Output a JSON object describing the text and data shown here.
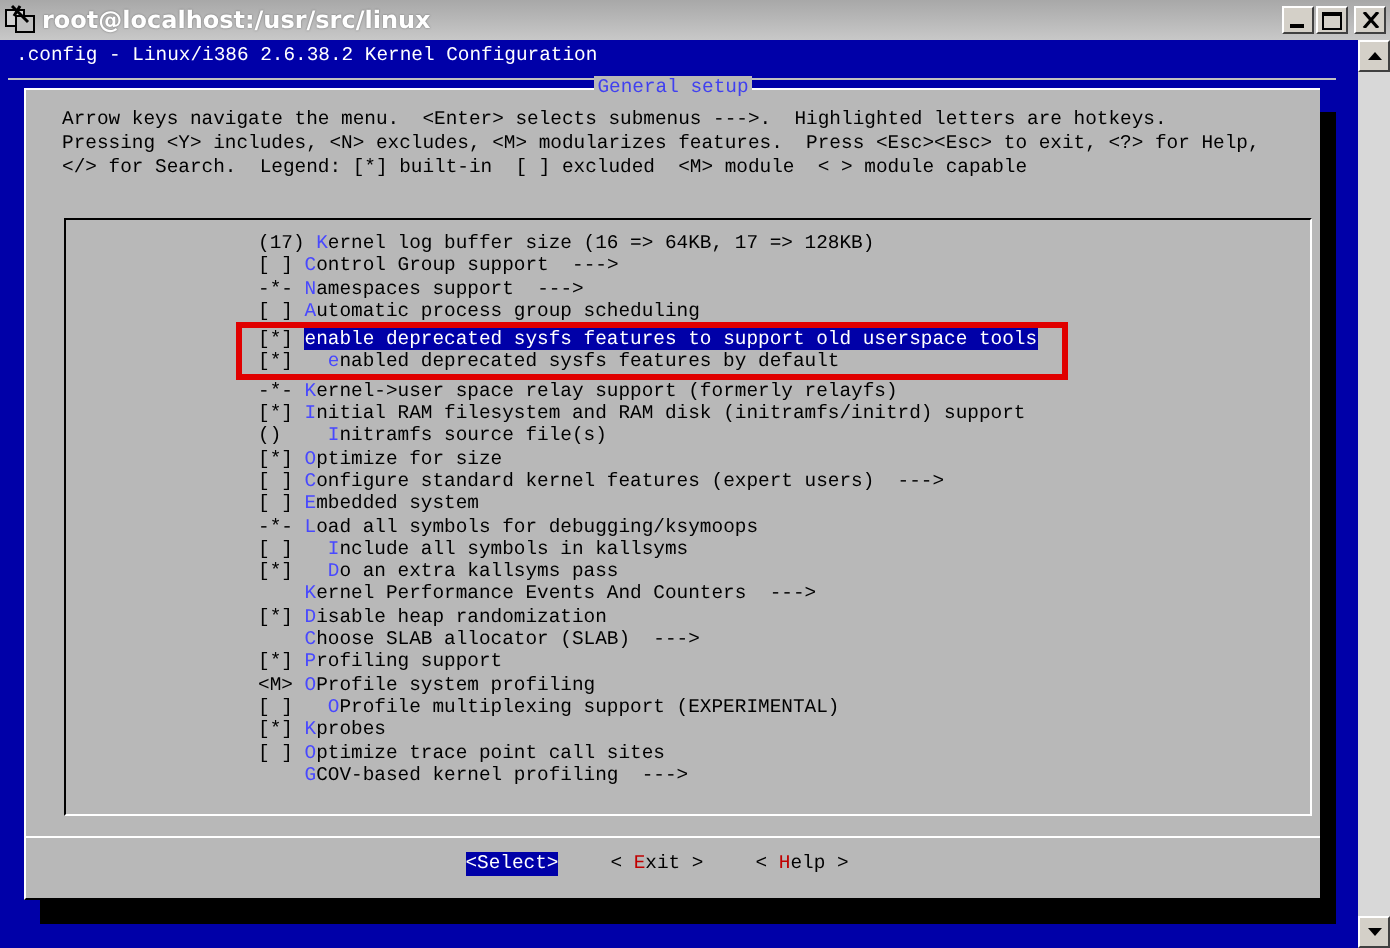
{
  "window": {
    "title": "root@localhost:/usr/src/linux"
  },
  "screen_title": ".config - Linux/i386 2.6.38.2 Kernel Configuration",
  "dialog": {
    "title": "General setup",
    "help_lines": [
      "Arrow keys navigate the menu.  <Enter> selects submenus --->.  Highlighted letters are hotkeys.",
      "Pressing <Y> includes, <N> excludes, <M> modularizes features.  Press <Esc><Esc> to exit, <?> for Help,",
      "</> for Search.  Legend: [*] built-in  [ ] excluded  <M> module  < > module capable"
    ],
    "items": [
      {
        "prefix": "(17)",
        "label": "Kernel log buffer size (16 => 64KB, 17 => 128KB)",
        "selected": false,
        "annotated": false
      },
      {
        "prefix": "[ ]",
        "label": "Control Group support",
        "suffix": "--->",
        "selected": false,
        "annotated": false
      },
      {
        "prefix": "-*-",
        "label": "Namespaces support",
        "suffix": "--->",
        "selected": false,
        "annotated": false
      },
      {
        "prefix": "[ ]",
        "label": "Automatic process group scheduling",
        "selected": false,
        "annotated": false
      },
      {
        "prefix": "[*]",
        "label": "enable deprecated sysfs features to support old userspace tools",
        "selected": true,
        "annotated": true,
        "children": [
          {
            "prefix": "[*]",
            "label": "enabled deprecated sysfs features by default",
            "selected": false,
            "annotated": true
          }
        ]
      },
      {
        "prefix": "-*-",
        "label": "Kernel->user space relay support (formerly relayfs)",
        "selected": false,
        "annotated": false
      },
      {
        "prefix": "[*]",
        "label": "Initial RAM filesystem and RAM disk (initramfs/initrd) support",
        "selected": false,
        "annotated": false,
        "children": [
          {
            "prefix": "()",
            "label": "Initramfs source file(s)",
            "selected": false,
            "annotated": false
          }
        ]
      },
      {
        "prefix": "[*]",
        "label": "Optimize for size",
        "selected": false,
        "annotated": false
      },
      {
        "prefix": "[ ]",
        "label": "Configure standard kernel features (expert users)",
        "suffix": "--->",
        "selected": false,
        "annotated": false
      },
      {
        "prefix": "[ ]",
        "label": "Embedded system",
        "selected": false,
        "annotated": false
      },
      {
        "prefix": "-*-",
        "label": "Load all symbols for debugging/ksymoops",
        "selected": false,
        "annotated": false,
        "children": [
          {
            "prefix": "[ ]",
            "label": "Include all symbols in kallsyms",
            "selected": false,
            "annotated": false
          },
          {
            "prefix": "[*]",
            "label": "Do an extra kallsyms pass",
            "selected": false,
            "annotated": false
          }
        ]
      },
      {
        "label": "Kernel Performance Events And Counters",
        "suffix": "--->",
        "selected": false,
        "annotated": false
      },
      {
        "prefix": "[*]",
        "label": "Disable heap randomization",
        "selected": false,
        "annotated": false
      },
      {
        "label": "Choose SLAB allocator (SLAB)",
        "suffix": "--->",
        "selected": false,
        "annotated": false
      },
      {
        "prefix": "[*]",
        "label": "Profiling support",
        "selected": false,
        "annotated": false
      },
      {
        "prefix": "<M>",
        "label": "OProfile system profiling",
        "selected": false,
        "annotated": false,
        "children": [
          {
            "prefix": "[ ]",
            "label": "OProfile multiplexing support (EXPERIMENTAL)",
            "selected": false,
            "annotated": false
          }
        ]
      },
      {
        "prefix": "[*]",
        "label": "Kprobes",
        "selected": false,
        "annotated": false
      },
      {
        "prefix": "[ ]",
        "label": "Optimize trace point call sites",
        "selected": false,
        "annotated": false
      },
      {
        "label": "GCOV-based kernel profiling",
        "suffix": "--->",
        "selected": false,
        "annotated": false
      }
    ],
    "buttons": [
      {
        "label": "<Select>",
        "selected": true
      },
      {
        "label": "< Exit >",
        "selected": false
      },
      {
        "label": "< Help >",
        "selected": false
      }
    ]
  }
}
